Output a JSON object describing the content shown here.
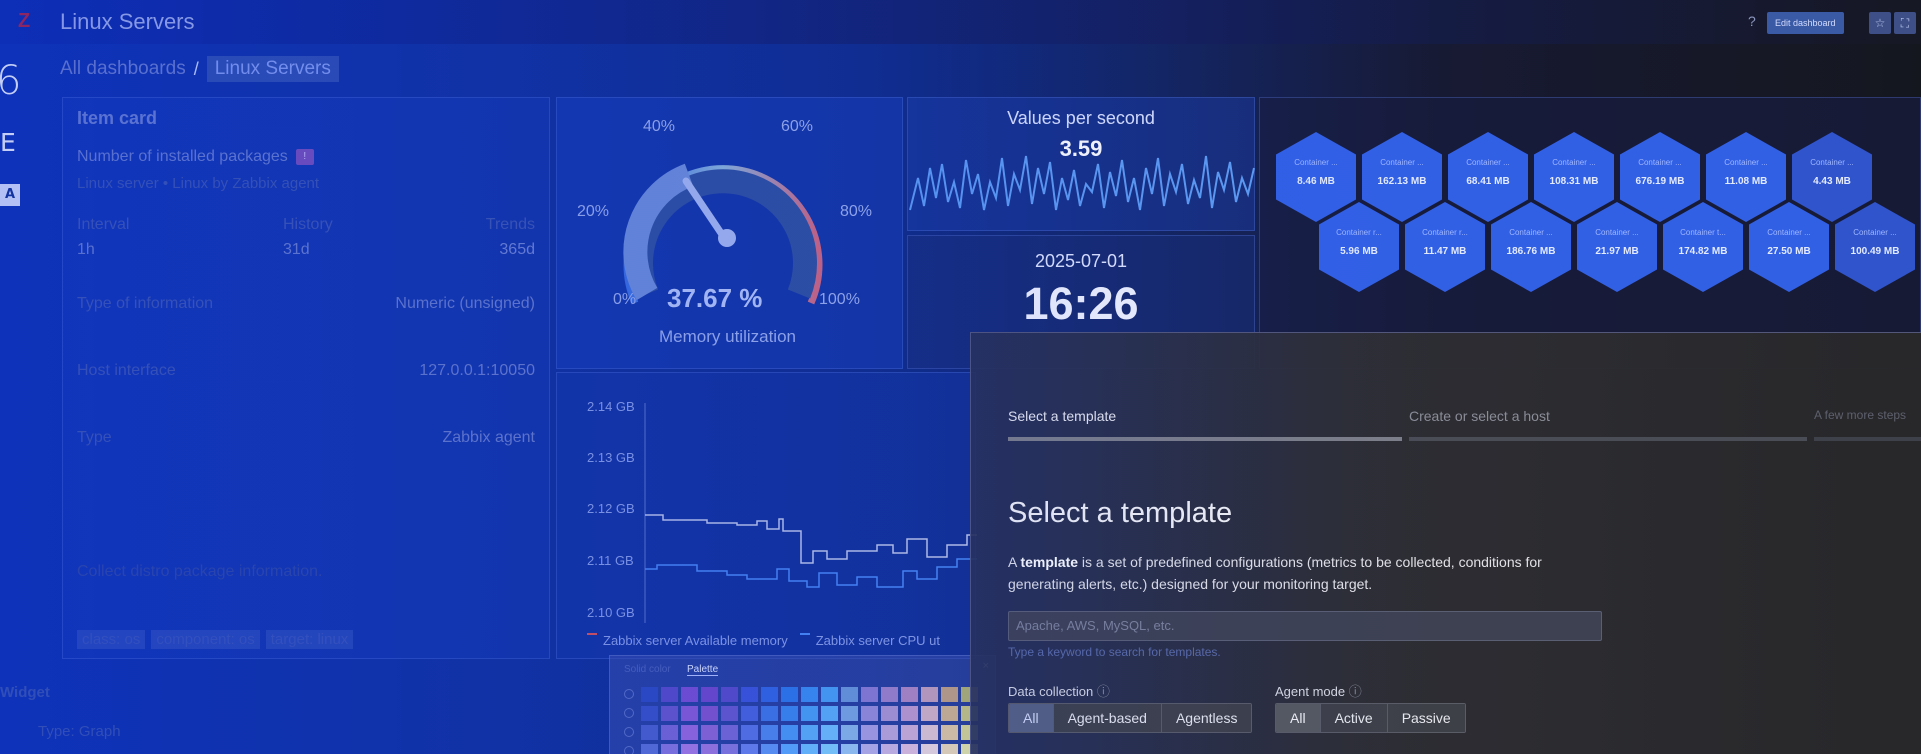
{
  "header": {
    "title": "Linux Servers",
    "help": "?",
    "edit_dashboard": "Edit dashboard",
    "star": "☆",
    "fullscreen": "⛶"
  },
  "breadcrumb": {
    "all": "All dashboards",
    "separator": "/",
    "current": "Linux Servers"
  },
  "left_edge": {
    "number": "6",
    "letter": "E",
    "badge": "A"
  },
  "item_card": {
    "title": "Item card",
    "item_name": "Number of installed packages",
    "badge": "!",
    "host": "Linux server  • Linux by Zabbix agent",
    "intervals": {
      "interval": "Interval",
      "history": "History",
      "trends": "Trends",
      "interval_value": "1h",
      "history_value": "31d",
      "trends_value": "365d"
    },
    "type_of_info_label": "Type of information",
    "type_of_info_value": "Numeric (unsigned)",
    "host_interface_label": "Host interface",
    "host_interface_value": "127.0.0.1:10050",
    "type_label": "Type",
    "type_value": "Zabbix agent",
    "description": "Collect distro package information.",
    "tags": [
      "class: os",
      "component: os",
      "target: linux"
    ]
  },
  "widget_form": {
    "label": "Widget",
    "type": "Type: Graph"
  },
  "gauge": {
    "value_text": "37.67 %",
    "value": 37.67,
    "name": "Memory utilization",
    "scale_labels": [
      "0%",
      "20%",
      "40%",
      "60%",
      "80%",
      "100%"
    ]
  },
  "values_per_second": {
    "title": "Values per second",
    "value": "3.59"
  },
  "clock": {
    "date": "2025-07-01",
    "time": "16:26"
  },
  "honeycomb": {
    "row1": [
      {
        "label": "Container ...",
        "value": "8.46 MB"
      },
      {
        "label": "Container ...",
        "value": "162.13 MB"
      },
      {
        "label": "Container ...",
        "value": "68.41 MB"
      },
      {
        "label": "Container ...",
        "value": "108.31 MB"
      },
      {
        "label": "Container ...",
        "value": "676.19 MB"
      },
      {
        "label": "Container ...",
        "value": "11.08 MB"
      },
      {
        "label": "Container ...",
        "value": "4.43 MB"
      }
    ],
    "row2": [
      {
        "label": "Container r...",
        "value": "5.96 MB"
      },
      {
        "label": "Container r...",
        "value": "11.47 MB"
      },
      {
        "label": "Container ...",
        "value": "186.76 MB"
      },
      {
        "label": "Container ...",
        "value": "21.97 MB"
      },
      {
        "label": "Container t...",
        "value": "174.82 MB"
      },
      {
        "label": "Container ...",
        "value": "27.50 MB"
      },
      {
        "label": "Container ...",
        "value": "100.49 MB"
      }
    ]
  },
  "graph": {
    "y_ticks": [
      "2.14 GB",
      "2.13 GB",
      "2.12 GB",
      "2.11 GB",
      "2.10 GB"
    ],
    "legend": [
      {
        "name": "Zabbix server Available memory",
        "color": "#e0524f"
      },
      {
        "name": "Zabbix server CPU ut",
        "color": "#4a8af5"
      }
    ]
  },
  "color_picker": {
    "tabs": [
      "Solid color",
      "Palette"
    ],
    "close": "×",
    "palette": [
      [
        "#2e4ac0",
        "#5a4ac8",
        "#7a4ed0",
        "#7048c8",
        "#5a4cc8",
        "#3d56d8",
        "#3266e0",
        "#2f78e8",
        "#3b8ef0",
        "#4aa0f4",
        "#6b98d8",
        "#8c7cd0",
        "#a082c8",
        "#b088c0",
        "#c4a0b8",
        "#c0a080",
        "#b0b070"
      ],
      [
        "#3a50c4",
        "#6a56cc",
        "#8a5ad4",
        "#8254cc",
        "#6858cc",
        "#4a64dc",
        "#4076e4",
        "#3c88ec",
        "#4aa0f4",
        "#5cb0f8",
        "#7aa8e0",
        "#9a8ed8",
        "#ae96d0",
        "#c09ccc",
        "#d4b4c4",
        "#d0b48c",
        "#c4c480"
      ],
      [
        "#4a60cc",
        "#7a66d4",
        "#9a6adc",
        "#9066d4",
        "#7868d4",
        "#5a74e4",
        "#5088ec",
        "#4c9af4",
        "#5cb0f8",
        "#70c0fc",
        "#8ab8e8",
        "#aaa0e0",
        "#bea8d8",
        "#d0b0d4",
        "#e0c8d0",
        "#e0c8a0",
        "#d4d490"
      ],
      [
        "#5a70d4",
        "#8a76dc",
        "#aa7ae4",
        "#a076dc",
        "#8878dc",
        "#6a84ec",
        "#6098f4",
        "#5caafc",
        "#6cc0fc",
        "#80d0fc",
        "#9ac8f0",
        "#bab0e8",
        "#ceb8e0",
        "#e0c0dc",
        "#ecd8dc",
        "#ecd8b4",
        "#e4e4a4"
      ]
    ]
  },
  "onboarding": {
    "steps": [
      "Select a template",
      "Create or select a host",
      "A few more steps"
    ],
    "title": "Select a template",
    "desc_prefix": "A ",
    "desc_bold": "template",
    "desc_rest": " is a set of predefined configurations (metrics to be collected, conditions for generating alerts, etc.) designed for your monitoring target.",
    "search_placeholder": "Apache, AWS, MySQL, etc.",
    "search_hint": "Type a keyword to search for templates.",
    "data_collection_label": "Data collection",
    "data_collection_options": [
      "All",
      "Agent-based",
      "Agentless"
    ],
    "agent_mode_label": "Agent mode",
    "agent_mode_options": [
      "All",
      "Active",
      "Passive"
    ],
    "info_icon": "ⓘ"
  },
  "colors": {
    "accent": "#3260e5",
    "gauge_low": "#3a6fe0",
    "gauge_high": "#d4667a",
    "sparkline": "#5e9cf2",
    "graph_line": "#c0c8e8"
  }
}
